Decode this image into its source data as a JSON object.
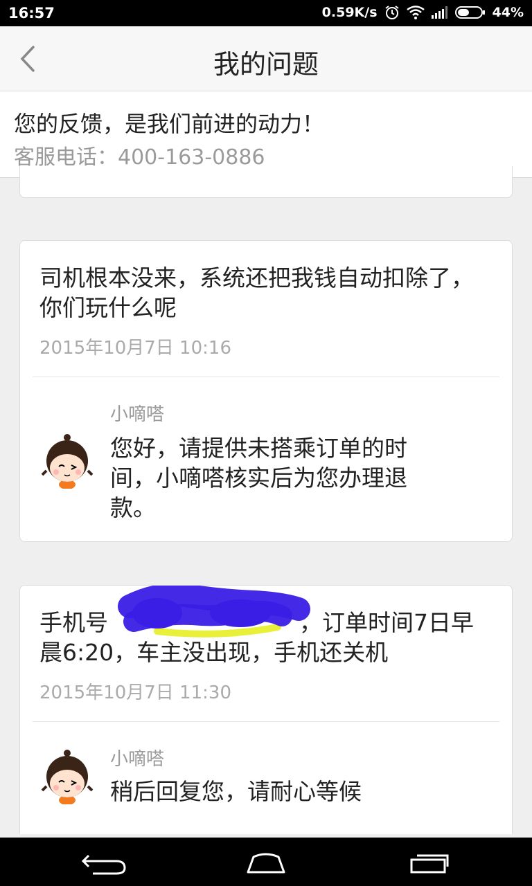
{
  "status_bar": {
    "time": "16:57",
    "network_speed": "0.59K/s",
    "battery_percent": "44%",
    "icons": [
      "alarm-icon",
      "wifi-icon",
      "signal-icon",
      "battery-icon"
    ]
  },
  "header": {
    "title": "我的问题",
    "back_icon": "chevron-left-icon"
  },
  "banner": {
    "slogan": "您的反馈，是我们前进的动力！",
    "phone": "客服电话：400-163-0886"
  },
  "questions": [
    {
      "text": "司机根本没来，系统还把我钱自动扣除了，你们玩什么呢",
      "date": "2015年10月7日 10:16",
      "reply_name": "小嘀嗒",
      "reply_text": "您好，请提供未搭乘订单的时间，小嘀嗒核实后为您办理退款。"
    },
    {
      "text_prefix": "手机号",
      "text_suffix": "，订单时间7日早晨6:20，车主没出现，手机还关机",
      "date": "2015年10月7日 11:30",
      "reply_name": "小嘀嗒",
      "reply_text": "稍后回复您，请耐心等候"
    }
  ],
  "colors": {
    "status_bar_bg": "#000000",
    "header_bg": "#f7f7f7",
    "page_bg": "#efefef",
    "secondary_text": "#9a9a9a",
    "redaction_blue": "#3a1ee6",
    "redaction_yellow": "#e8f03a",
    "avatar_shirt": "#f47a1f"
  }
}
